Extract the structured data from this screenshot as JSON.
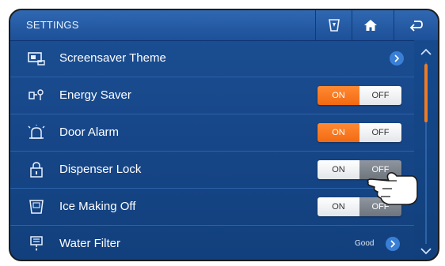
{
  "header": {
    "title": "SETTINGS",
    "icons": [
      "dispenser-cup-icon",
      "home-icon",
      "back-arrow-icon"
    ]
  },
  "rows": [
    {
      "label": "Screensaver Theme",
      "icon": "screen-icon",
      "control": "chevron"
    },
    {
      "label": "Energy Saver",
      "icon": "energy-icon",
      "on_label": "ON",
      "off_label": "OFF",
      "state": "on"
    },
    {
      "label": "Door Alarm",
      "icon": "alarm-icon",
      "on_label": "ON",
      "off_label": "OFF",
      "state": "on"
    },
    {
      "label": "Dispenser Lock",
      "icon": "lock-icon",
      "on_label": "ON",
      "off_label": "OFF",
      "state": "pressed"
    },
    {
      "label": "Ice Making Off",
      "icon": "ice-icon",
      "on_label": "ON",
      "off_label": "OFF",
      "state": "off"
    },
    {
      "label": "Water Filter",
      "icon": "filter-icon",
      "status": "Good",
      "control": "chevron"
    }
  ],
  "colors": {
    "accent": "#f26a12",
    "header": "#2f68b1",
    "background": "#164586"
  },
  "scroll": {
    "position": 0.0
  }
}
